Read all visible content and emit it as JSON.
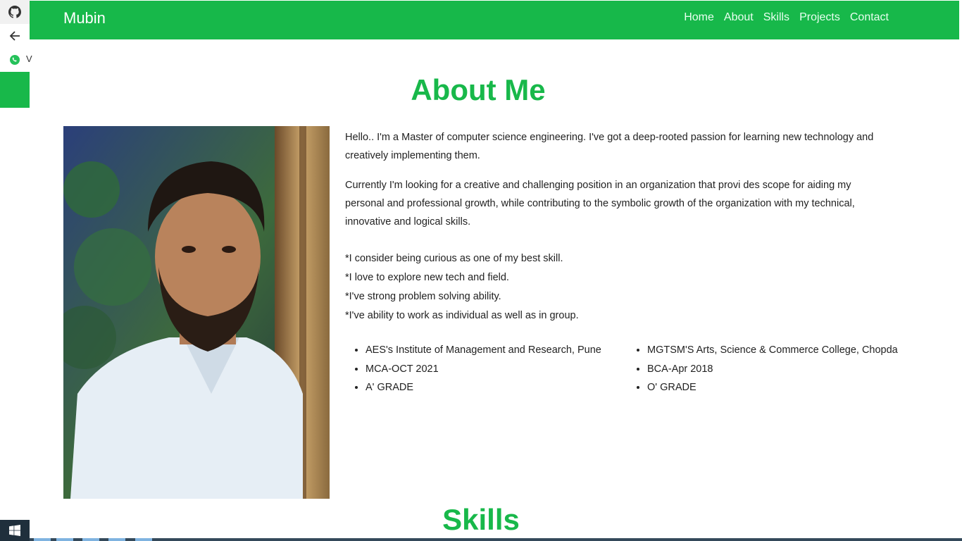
{
  "navbar": {
    "brand": "Mubin",
    "links": [
      "Home",
      "About",
      "Skills",
      "Projects",
      "Contact"
    ]
  },
  "sidebar": {
    "whatsapp_label": "V"
  },
  "about": {
    "title": "About Me",
    "intro": "Hello.. I'm a Master of computer science engineering. I've got a deep-rooted passion for learning new technology and creatively implementing them.",
    "goal": "Currently I'm looking for a creative and challenging position in an organization that provi des scope for aiding my personal and professional growth, while contributing to the symbolic growth of the organization with my technical, innovative and logical skills.",
    "traits": [
      "*I consider being curious as one of my best skill.",
      "*I love to explore new tech and field.",
      "*I've strong problem solving ability.",
      "*I've ability to work as individual as well as in group."
    ],
    "education": [
      [
        "AES's Institute of Management and Research, Pune",
        "MCA-OCT 2021",
        "A' GRADE"
      ],
      [
        "MGTSM'S Arts, Science & Commerce College, Chopda",
        "BCA-Apr 2018",
        "O' GRADE"
      ]
    ]
  },
  "skills": {
    "title": "Skills"
  },
  "colors": {
    "brand_green": "#17b84a",
    "title_green": "#18b84a"
  }
}
